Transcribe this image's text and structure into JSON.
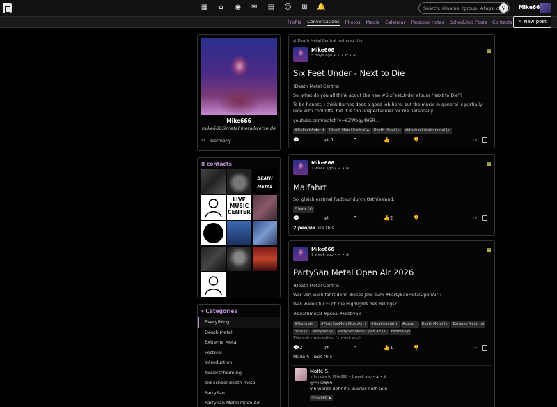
{
  "topbar": {
    "search_placeholder": "Search: @name, !group, #tags, content",
    "user_name": "Mike666",
    "nav_icons": [
      "apps-icon",
      "home-icon",
      "network-icon",
      "mail-icon",
      "calendar-icon",
      "contacts-icon",
      "community-icon",
      "bell-icon"
    ],
    "nav_glyphs": [
      "▦",
      "⌂",
      "◉",
      "✉",
      "▤",
      "☺",
      "⊞",
      "🔔"
    ]
  },
  "tabs": [
    "Profile",
    "Conversations",
    "Photos",
    "Media",
    "Calendar",
    "Personal notes",
    "Scheduled Posts",
    "Contacts"
  ],
  "active_tab": "Conversations",
  "new_post_label": "New post",
  "profile": {
    "name": "Mike666",
    "email": "mike666@metal.metalliverse.de",
    "location": "Germany"
  },
  "contacts": {
    "title": "8 contacts",
    "live_text": "LIVE MUSIC CENTER",
    "death_text": "DEATH METAL"
  },
  "categories": {
    "title": "Categories",
    "items": [
      "Everything",
      "Death Metal",
      "Extreme Metal",
      "Festival",
      "Introduction",
      "Neuerscheinung",
      "old school death metal",
      "PartySan",
      "PartySan Metal Open Air"
    ]
  },
  "posts": [
    {
      "reshare": "Death Metal Central reshared this.",
      "author": "Mike666",
      "meta": "5 days ago • ✓ • ⇄ • ☍",
      "title": "Six Feet Under - Next to Die",
      "lines": [
        "!Death Metal Central",
        "So, what do you all think about the new #SixFeetUnder album \"Next to Die\"?",
        "To be honest, I think Barnes does a good job here, but the music in general is partially nice with cool riffs, but it is too unspectacular for me personally ...",
        "youtube.com/watch?v=6ZWbgy4HER..."
      ],
      "tags": [
        "#SixFeetUnder ✝",
        "!Death Metal Central ♟",
        "Death Metal (x)",
        "old school death metal (x)"
      ],
      "reshare_count": "1"
    },
    {
      "author": "Mike666",
      "meta": "1 week ago • ✓ • ⊕",
      "title": "Maifahrt",
      "lines": [
        "So, gleich erstmal Radtour durch Ostfriesland."
      ],
      "tags": [
        "Private (x)"
      ],
      "like_count": "2",
      "likes_bold": "2 people",
      "likes_text": "like this"
    },
    {
      "author": "Mike666",
      "meta": "1 week ago • ✓ • ⊕",
      "title": "PartySan Metal Open Air 2026",
      "lines": [
        "!Death Metal Central",
        "Wer von Euch fährt denn dieses Jahr zum #PartySanMetalOpenAir ?",
        "Was wären für Euch die Highlights des Billings?",
        "#deathmetal #psoa #Festivals"
      ],
      "tags": [
        "#Festivals ✝",
        "#PartySanMetalOpenAir ✝",
        "#deathmetal ✝",
        "#psoa ✝",
        "Death Metal (x)",
        "Extreme Metal (x)",
        "psoa (x)",
        "PartySan (x)",
        "PartySan Metal Open Air (x)",
        "Festival (x)"
      ],
      "edited": "This entry was edited (1 week ago)",
      "comment_count": "2",
      "like_count": "1",
      "likes_text": "Maile S. likes this.",
      "reply": {
        "author": "Malte S.",
        "meta": "↰ In reply to Mike666 • 1 week ago • ♟ • ⊕",
        "mention": "@Mike666",
        "text": "Ich werde definitiv wieder dort sein.",
        "tag": "!Mike666 ♟"
      }
    }
  ]
}
